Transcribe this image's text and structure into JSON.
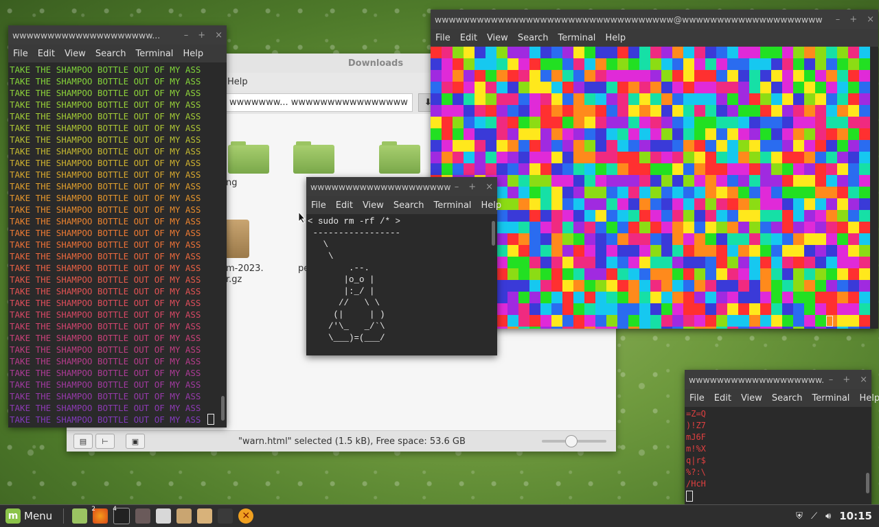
{
  "file_manager": {
    "title": "Downloads",
    "menu_help": "Help",
    "crumb": "wwwwwww... wwwwwwwwwwwwwwww",
    "crumb_btn": "D",
    "items": [
      {
        "label": "ng"
      },
      {
        "label": ""
      },
      {
        "label": ""
      },
      {
        "label": "m-2023.\nr.gz"
      },
      {
        "label": "pe"
      }
    ],
    "status_text": "\"warn.html\" selected (1.5 kB), Free space: 53.6 GB",
    "zoom_level": 0.45
  },
  "menu": {
    "file": "File",
    "edit": "Edit",
    "view": "View",
    "search": "Search",
    "terminal": "Terminal",
    "help": "Help"
  },
  "term_left": {
    "title": "wwwwwwwwwwwwwwwwwwww...",
    "line_text": "TAKE THE SHAMPOO BOTTLE OUT OF MY ASS",
    "line_colors": [
      "#7fd43a",
      "#85d43a",
      "#8dd23a",
      "#98cf38",
      "#a3cb36",
      "#aec634",
      "#b9c033",
      "#c4b931",
      "#cfb12f",
      "#d8a82e",
      "#e09f2d",
      "#e5962c",
      "#e98d2d",
      "#ec832f",
      "#ed7a33",
      "#ed7137",
      "#ec693d",
      "#ea6144",
      "#e75a4b",
      "#e35353",
      "#de4d5b",
      "#d84864",
      "#d1446e",
      "#c94178",
      "#c03e82",
      "#b63c8c",
      "#ac3b96",
      "#a13aa0",
      "#963aa9",
      "#8c3ab2",
      "#823abb"
    ]
  },
  "term_mid": {
    "title": "wwwwwwwwwwwwwwwwwwwww...",
    "cowsay": " _________________\n< sudo rm -rf /* >\n -----------------\n   \\\n    \\\n        .--.\n       |o_o |\n       |:_/ |\n      //   \\ \\\n     (|     | )\n    /'\\_   _/`\\\n    \\___)=(___/"
  },
  "term_big": {
    "title": "wwwwwwwwwwwwwwwwwwwwwwwwwwwwwwwwww@wwwwwwwwwwwwwwwwwwww",
    "palette": [
      "#ff3030",
      "#ff8a1c",
      "#ffe81c",
      "#8cdc14",
      "#22e022",
      "#16e0a6",
      "#16c8f0",
      "#2a6cf0",
      "#3a3ad8",
      "#a02ae0",
      "#e02ad8",
      "#f02a80"
    ]
  },
  "term_small": {
    "title": "wwwwwwwwwwwwwwwwwww...",
    "lines": [
      "=Z=Q",
      ")!Z7",
      "mJ6F",
      "m!%X",
      "q|r$",
      "%?:\\",
      "/HcH"
    ]
  },
  "panel": {
    "menu_label": "Menu",
    "terminal_badge": "4",
    "firefox_badge": "2",
    "clock": "10:15"
  }
}
